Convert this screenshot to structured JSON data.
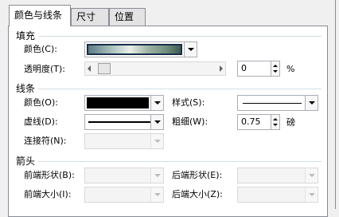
{
  "tabs": [
    {
      "label": "颜色与线条"
    },
    {
      "label": "尺寸"
    },
    {
      "label": "位置"
    }
  ],
  "fill": {
    "section_label": "填充",
    "color_label": "颜色(C):",
    "transparency_label": "透明度(T):",
    "transparency_value": "0",
    "transparency_unit": "%"
  },
  "line": {
    "section_label": "线条",
    "color_label": "颜色(O):",
    "dash_label": "虚线(D):",
    "connector_label": "连接符(N):",
    "style_label": "样式(S):",
    "weight_label": "粗细(W):",
    "weight_value": "0.75",
    "weight_unit": "磅"
  },
  "arrows": {
    "section_label": "箭头",
    "begin_style_label": "前端形状(B):",
    "end_style_label": "后端形状(E):",
    "begin_size_label": "前端大小(I):",
    "end_size_label": "后端大小(Z):"
  }
}
